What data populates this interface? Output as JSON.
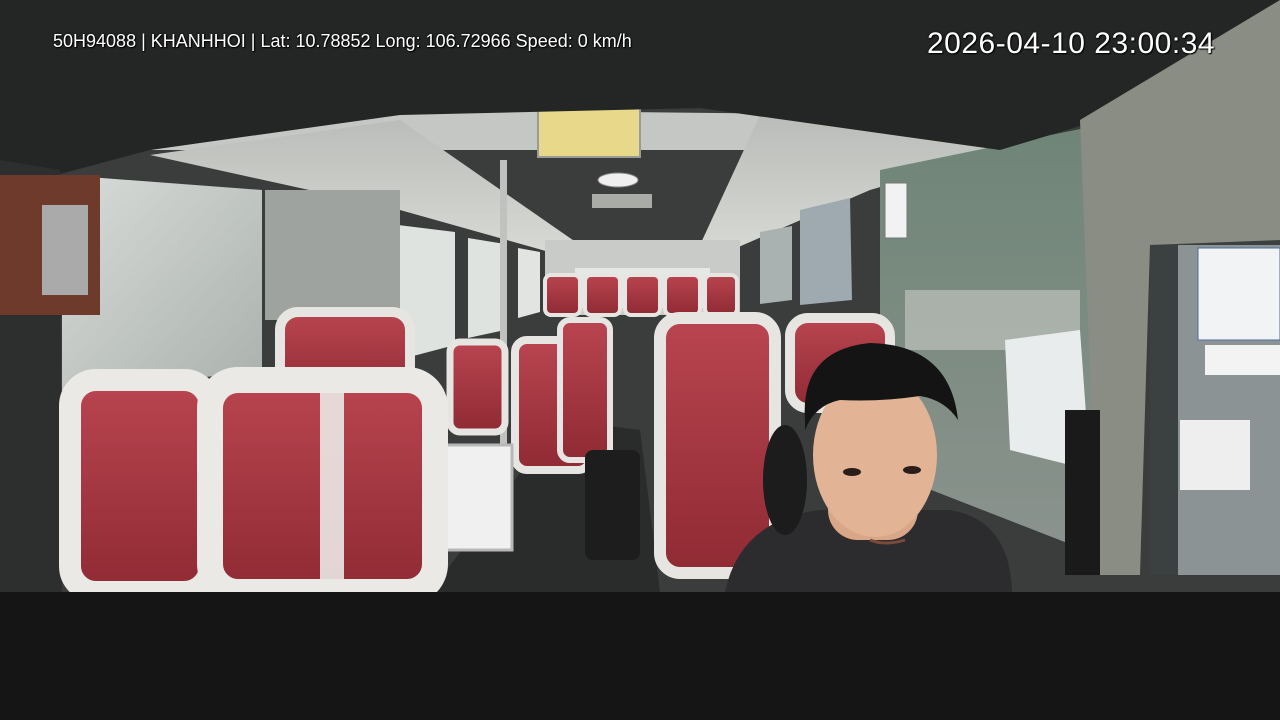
{
  "overlay": {
    "info_line": "50H94088 | KHANHHOI | Lat: 10.78852 Long: 106.72966 Speed: 0 km/h",
    "timestamp": "2026-04-10 23:00:34"
  },
  "scene": {
    "description_icon": "bus-interior-camera-view",
    "colors": {
      "seat_red": "#a8323a",
      "seat_white": "#e8e6e4",
      "ceiling": "#c9ccc8",
      "frame_dark": "#1c1e1d",
      "background_bar": "#151515"
    }
  }
}
